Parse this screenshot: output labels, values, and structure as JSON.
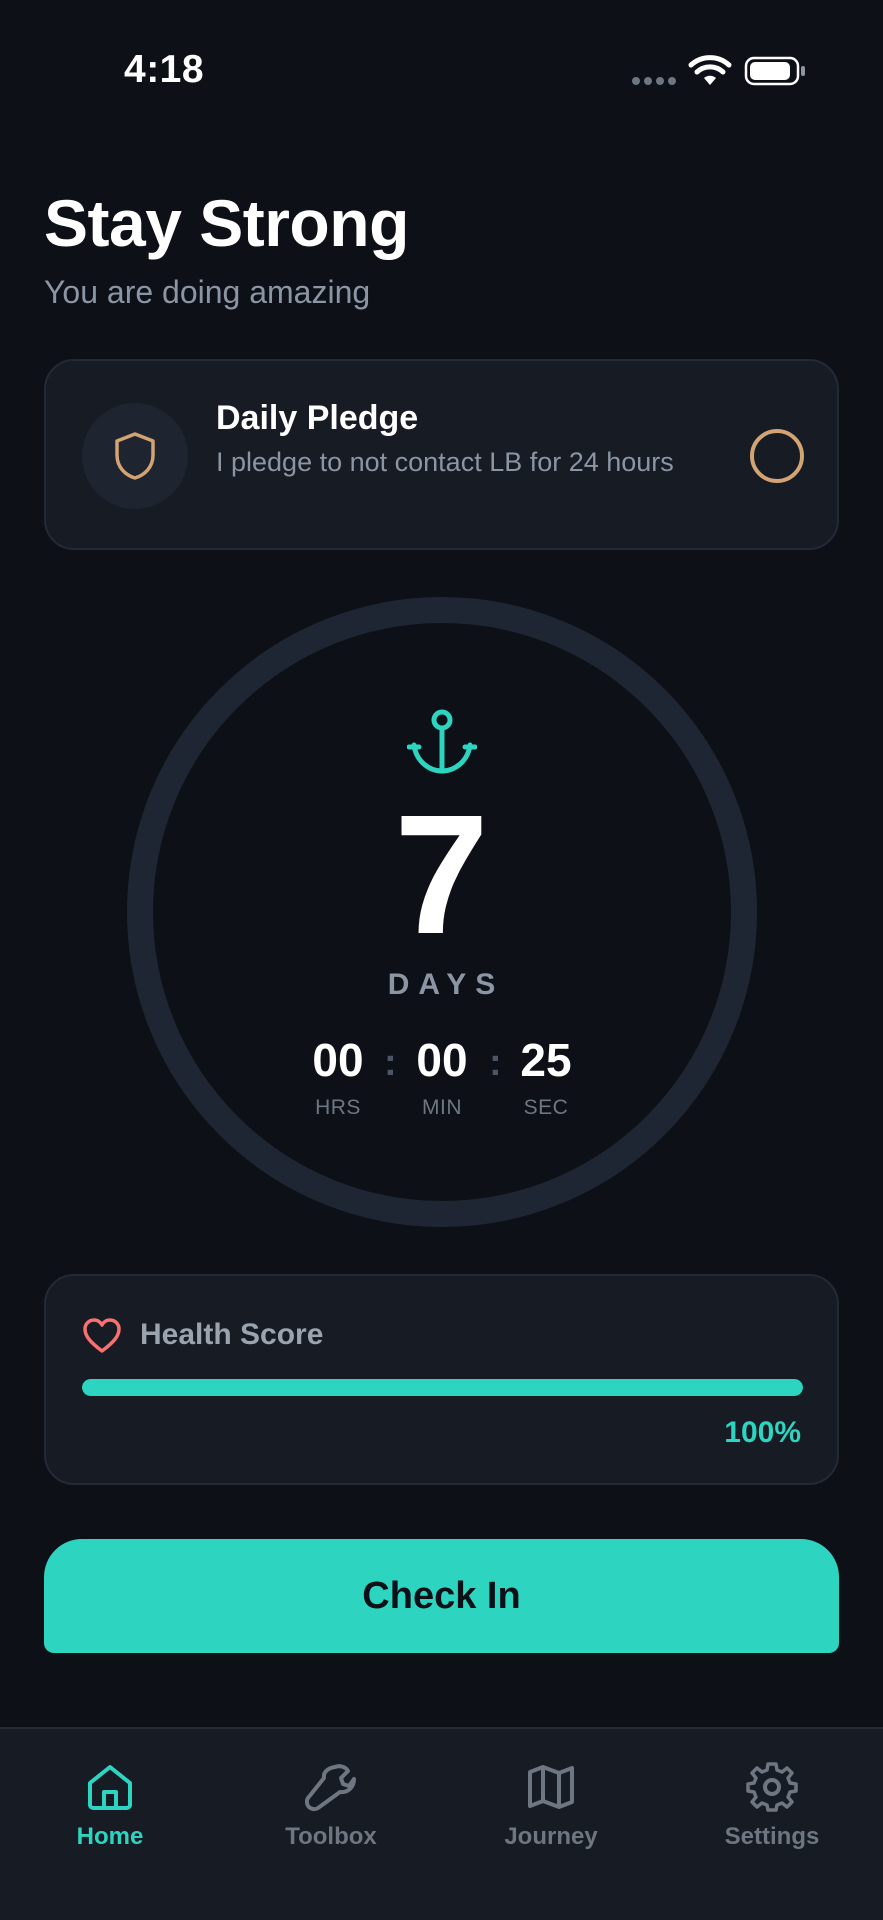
{
  "status_bar": {
    "time": "4:18"
  },
  "header": {
    "title": "Stay Strong",
    "subtitle": "You are doing amazing"
  },
  "pledge": {
    "title": "Daily Pledge",
    "description": "I pledge to not contact LB for 24 hours",
    "icon": "shield-icon",
    "checked": false,
    "accent_color": "#d4a373"
  },
  "counter": {
    "icon": "anchor-icon",
    "days": "7",
    "days_label": "DAYS",
    "hours": "00",
    "hours_label": "HRS",
    "minutes": "00",
    "minutes_label": "MIN",
    "seconds": "25",
    "seconds_label": "SEC",
    "separator": ":"
  },
  "health": {
    "icon": "heart-icon",
    "title": "Health Score",
    "progress": 1.0,
    "percent_text": "100%"
  },
  "checkin": {
    "label": "Check In"
  },
  "tabs": [
    {
      "label": "Home",
      "icon": "home-icon",
      "active": true
    },
    {
      "label": "Toolbox",
      "icon": "wrench-icon",
      "active": false
    },
    {
      "label": "Journey",
      "icon": "map-icon",
      "active": false
    },
    {
      "label": "Settings",
      "icon": "gear-icon",
      "active": false
    }
  ],
  "colors": {
    "background": "#0d1117",
    "card": "#161b24",
    "accent": "#2dd4bf",
    "pledge_accent": "#d4a373",
    "heart": "#f87171",
    "muted": "#8b95a3"
  }
}
